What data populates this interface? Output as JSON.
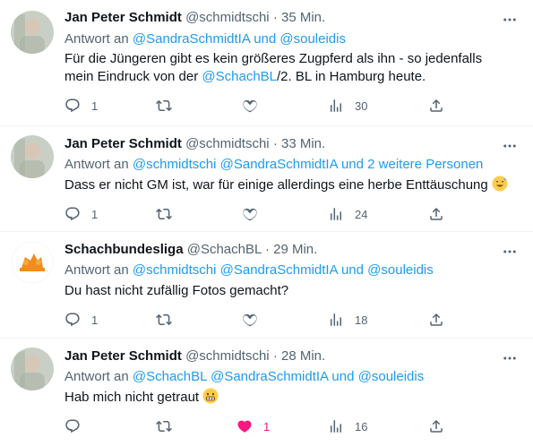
{
  "tweets": [
    {
      "name": "Jan Peter Schmidt",
      "handle": "@schmidtschi",
      "time": "· 35 Min.",
      "reply_prefix": "Antwort an ",
      "reply_mentions": [
        "@SandraSchmidtIA",
        "und",
        "@souleidis"
      ],
      "text_line1": "Für die Jüngeren gibt es kein größeres Zugpferd als ihn - so jedenfalls",
      "text_line2_a": "mein Eindruck von der ",
      "text_line2_mention": "@SchachBL",
      "text_line2_b": "/2. BL in Hamburg heute.",
      "replies": "1",
      "views": "30"
    },
    {
      "name": "Jan Peter Schmidt",
      "handle": "@schmidtschi",
      "time": "· 33 Min.",
      "reply_prefix": "Antwort an ",
      "reply_mentions": [
        "@schmidtschi",
        "@SandraSchmidtIA",
        "und",
        "2 weitere Personen"
      ],
      "text": "Dass er nicht GM ist, war für einige allerdings eine herbe Enttäuschung",
      "replies": "1",
      "views": "24"
    },
    {
      "name": "Schachbundesliga",
      "handle": "@SchachBL",
      "time": "· 29 Min.",
      "reply_prefix": "Antwort an ",
      "reply_mentions": [
        "@schmidtschi",
        "@SandraSchmidtIA",
        "und",
        "@souleidis"
      ],
      "text": "Du hast nicht zufällig Fotos gemacht?",
      "replies": "1",
      "views": "18"
    },
    {
      "name": "Jan Peter Schmidt",
      "handle": "@schmidtschi",
      "time": "· 28 Min.",
      "reply_prefix": "Antwort an ",
      "reply_mentions": [
        "@SchachBL",
        "@SandraSchmidtIA",
        "und",
        "@souleidis"
      ],
      "text": "Hab mich nicht getraut",
      "likes": "1",
      "views": "16"
    }
  ],
  "colors": {
    "accent": "#1d9bf0",
    "secondary_text": "#536471",
    "like": "#f91880"
  },
  "icons": [
    "reply-icon",
    "retweet-icon",
    "like-icon",
    "views-icon",
    "share-icon",
    "more-icon"
  ]
}
